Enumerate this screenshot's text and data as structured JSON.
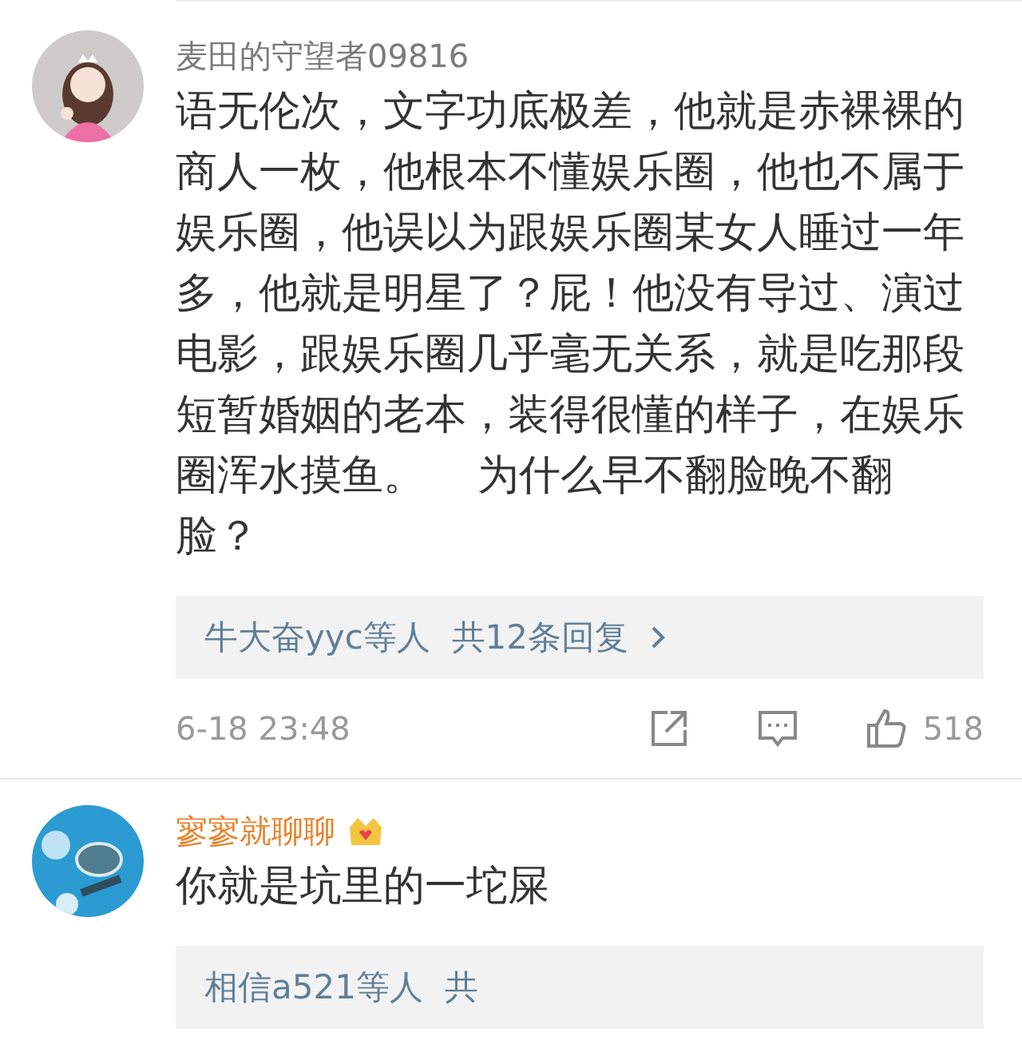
{
  "comments": [
    {
      "author": "麦田的守望者09816",
      "vip": false,
      "text": "语无伦次，文字功底极差，他就是赤裸裸的商人一枚，他根本不懂娱乐圈，他也不属于娱乐圈，他误以为跟娱乐圈某女人睡过一年多，他就是明星了？屁！他没有导过、演过电影，跟娱乐圈几乎毫无关系，就是吃那段短暂婚姻的老本，装得很懂的样子，在娱乐圈浑水摸鱼。    为什么早不翻脸晚不翻脸？",
      "replies": {
        "text": "牛大奋yyc等人  共12条回复",
        "more": true
      },
      "footer": {
        "time": "6-18 23:48",
        "likes": "518"
      }
    },
    {
      "author": "寥寥就聊聊",
      "vip": true,
      "text": "你就是坑里的一坨屎",
      "replies": {
        "text": "相信a521等人  共",
        "more": false
      }
    }
  ]
}
